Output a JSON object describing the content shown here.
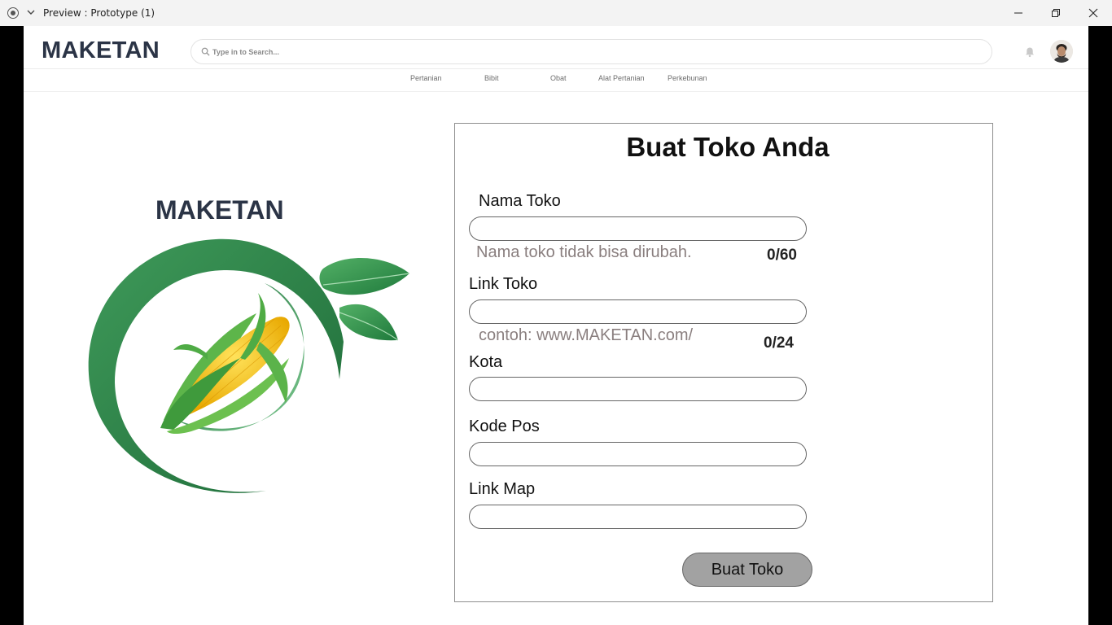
{
  "window": {
    "title": "Preview : Prototype (1)"
  },
  "header": {
    "logo": "MAKETAN",
    "search_placeholder": "Type in to Search..."
  },
  "nav": {
    "items": [
      {
        "label": "Pertanian"
      },
      {
        "label": "Bibit"
      },
      {
        "label": "Obat"
      },
      {
        "label": "Alat Pertanian"
      },
      {
        "label": "Perkebunan"
      }
    ]
  },
  "brand": {
    "title": "MAKETAN"
  },
  "form": {
    "title": "Buat Toko Anda",
    "nama_toko": {
      "label": "Nama Toko",
      "value": "",
      "hint": "Nama toko tidak bisa dirubah.",
      "counter": "0/60"
    },
    "link_toko": {
      "label": "Link Toko",
      "value": "",
      "hint": "contoh: www.MAKETAN.com/",
      "counter": "0/24"
    },
    "kota": {
      "label": "Kota",
      "value": ""
    },
    "kode_pos": {
      "label": "Kode Pos",
      "value": ""
    },
    "link_map": {
      "label": "Link Map",
      "value": ""
    },
    "submit_label": "Buat Toko"
  },
  "colors": {
    "brand_navy": "#2b3446",
    "leaf_green": "#2f8a4c",
    "button_gray": "#a2a2a2",
    "hint_text": "#8a7f7f"
  },
  "icons": [
    "record-icon",
    "chevron-down-icon",
    "minimize-icon",
    "maximize-icon",
    "close-icon",
    "search-icon",
    "bell-icon",
    "avatar",
    "corn-emblem"
  ]
}
